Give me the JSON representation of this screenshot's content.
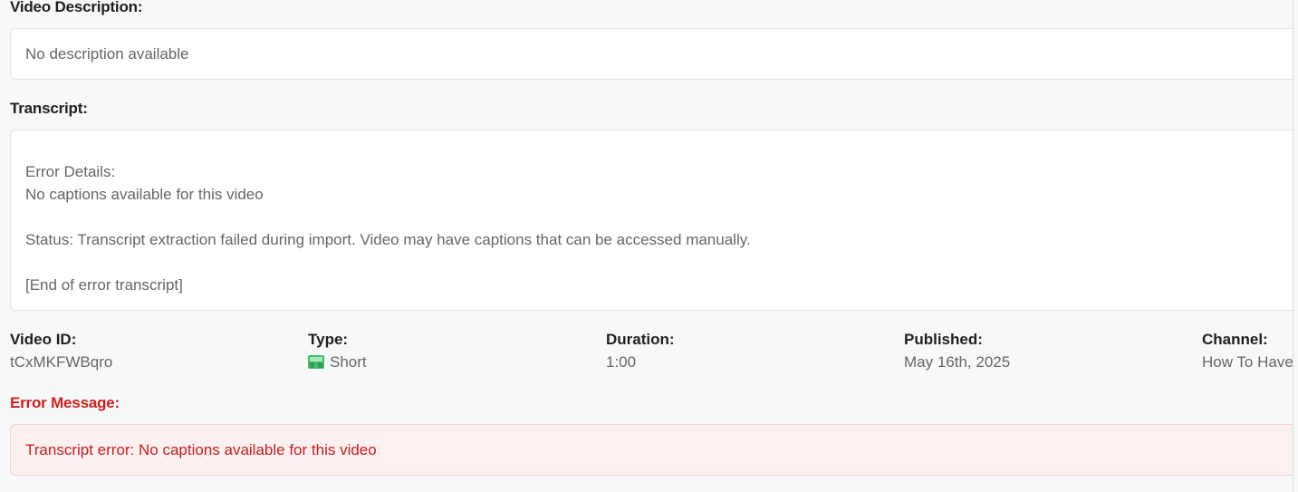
{
  "description": {
    "label": "Video Description:",
    "text": "No description available"
  },
  "transcript": {
    "label": "Transcript:",
    "lines": [
      "Error Details:",
      "No captions available for this video",
      "",
      "Status: Transcript extraction failed during import. Video may have captions that can be accessed manually.",
      "",
      "[End of error transcript]"
    ]
  },
  "meta": {
    "video_id": {
      "label": "Video ID:",
      "value": "tCxMKFWBqro"
    },
    "type": {
      "label": "Type:",
      "value": "Short",
      "icon": "shorts-icon"
    },
    "duration": {
      "label": "Duration:",
      "value": "1:00"
    },
    "published": {
      "label": "Published:",
      "value": "May 16th, 2025"
    },
    "channel": {
      "label": "Channel:",
      "value": "How To Have"
    }
  },
  "error": {
    "label": "Error Message:",
    "text": "Transcript error: No captions available for this video"
  },
  "colors": {
    "error_text": "#c81e1e",
    "error_bg": "#fdf0f0",
    "page_bg": "#f7f8fa",
    "short_icon": "#3fbf6a"
  }
}
